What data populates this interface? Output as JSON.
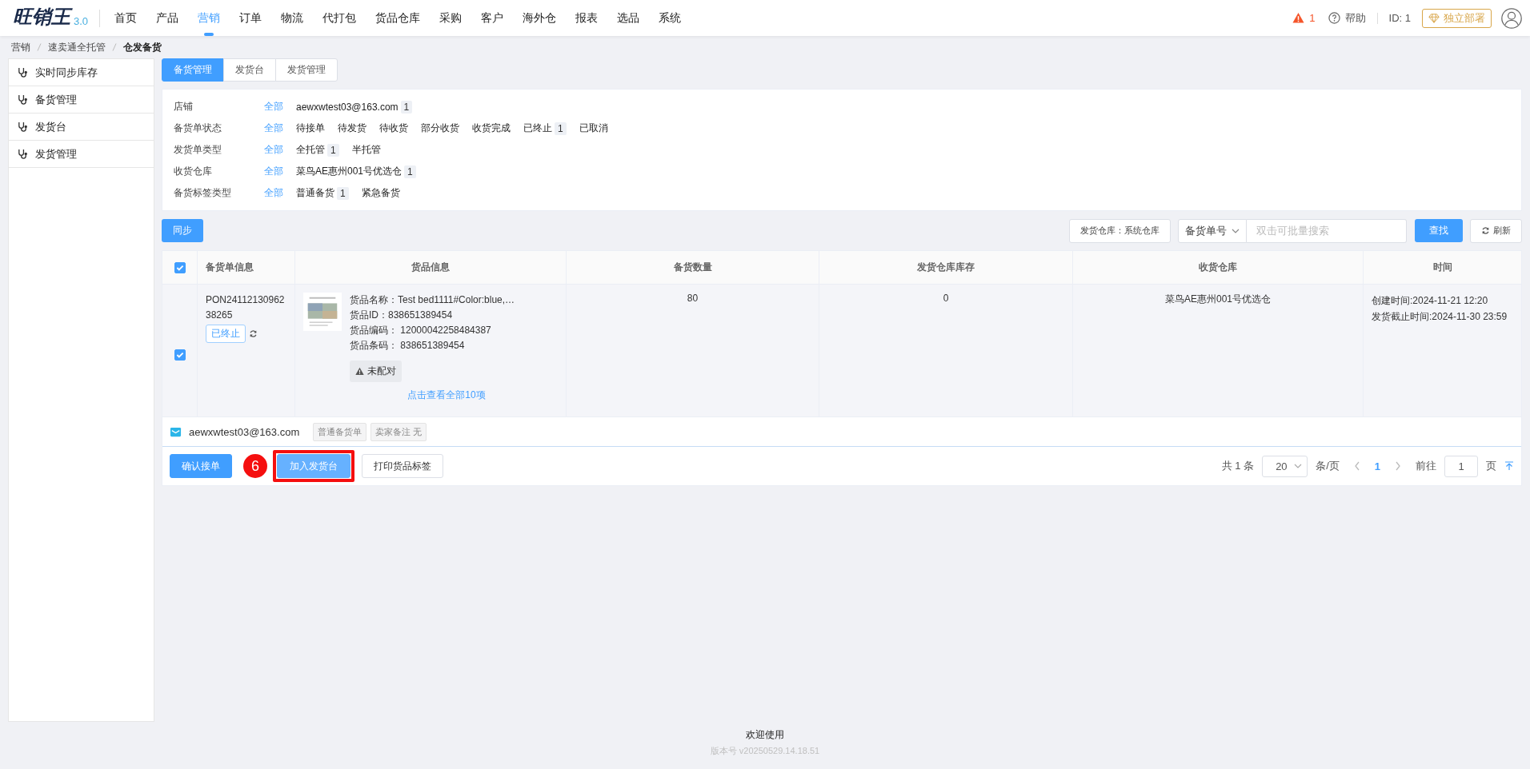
{
  "header": {
    "logo": "旺销王",
    "version": "3.0",
    "nav": [
      {
        "label": "首页",
        "selected": false
      },
      {
        "label": "产品",
        "selected": false
      },
      {
        "label": "营销",
        "selected": true
      },
      {
        "label": "订单",
        "selected": false
      },
      {
        "label": "物流",
        "selected": false
      },
      {
        "label": "代打包",
        "selected": false
      },
      {
        "label": "货品仓库",
        "selected": false
      },
      {
        "label": "采购",
        "selected": false
      },
      {
        "label": "客户",
        "selected": false
      },
      {
        "label": "海外仓",
        "selected": false
      },
      {
        "label": "报表",
        "selected": false
      },
      {
        "label": "选品",
        "selected": false
      },
      {
        "label": "系统",
        "selected": false
      }
    ],
    "alert_count": "1",
    "help": "帮助",
    "user_id": "ID: 1",
    "deploy_button": "独立部署"
  },
  "breadcrumb": [
    "营销",
    "速卖通全托管",
    "仓发备货"
  ],
  "sidebar": {
    "items": [
      "实时同步库存",
      "备货管理",
      "发货台",
      "发货管理"
    ]
  },
  "tabs": [
    {
      "label": "备货管理",
      "selected": true
    },
    {
      "label": "发货台",
      "selected": false
    },
    {
      "label": "发货管理",
      "selected": false
    }
  ],
  "filters": [
    {
      "label": "店铺",
      "options": [
        {
          "label": "全部",
          "selected": true
        },
        {
          "label": "aewxwtest03@163.com",
          "count": "1",
          "selected": false
        }
      ]
    },
    {
      "label": "备货单状态",
      "options": [
        {
          "label": "全部",
          "selected": true
        },
        {
          "label": "待接单",
          "selected": false
        },
        {
          "label": "待发货",
          "selected": false
        },
        {
          "label": "待收货",
          "selected": false
        },
        {
          "label": "部分收货",
          "selected": false
        },
        {
          "label": "收货完成",
          "selected": false
        },
        {
          "label": "已终止",
          "count": "1",
          "selected": false
        },
        {
          "label": "已取消",
          "selected": false
        }
      ]
    },
    {
      "label": "发货单类型",
      "options": [
        {
          "label": "全部",
          "selected": true
        },
        {
          "label": "全托管",
          "count": "1",
          "selected": false
        },
        {
          "label": "半托管",
          "selected": false
        }
      ]
    },
    {
      "label": "收货仓库",
      "options": [
        {
          "label": "全部",
          "selected": true
        },
        {
          "label": "菜鸟AE惠州001号优选仓",
          "count": "1",
          "selected": false
        }
      ]
    },
    {
      "label": "备货标签类型",
      "options": [
        {
          "label": "全部",
          "selected": true
        },
        {
          "label": "普通备货",
          "count": "1",
          "selected": false
        },
        {
          "label": "紧急备货",
          "selected": false
        }
      ]
    }
  ],
  "toolbar": {
    "sync_button": "同步",
    "ship_warehouse": "发货仓库：系统仓库",
    "search_type": "备货单号",
    "search_placeholder": "双击可批量搜索",
    "search_button": "查找",
    "refresh_button": "刷新"
  },
  "table": {
    "header_checked": true,
    "columns": [
      "备货单信息",
      "货品信息",
      "备货数量",
      "发货仓库库存",
      "收货仓库",
      "时间"
    ],
    "rows": [
      {
        "checked": true,
        "order_no": "PON2411213096238265",
        "status": "已终止",
        "product_lines": [
          "货品名称：Test bed1111#Color:blue,…",
          "货品ID：838651389454",
          "货品编码：  12000042258484387",
          "货品条码：  838651389454"
        ],
        "match_tag": "未配对",
        "more_link": "点击查看全部10项",
        "quantity": "80",
        "stock": "0",
        "warehouse": "菜鸟AE惠州001号优选仓",
        "times": [
          "创建时间:2024-11-21 12:20",
          "发货截止时间:2024-11-30 23:59"
        ],
        "store_email": "aewxwtest03@163.com",
        "tags": [
          "普通备货单",
          "卖家备注 无"
        ]
      }
    ]
  },
  "actions": [
    {
      "label": "确认接单",
      "kind": "primary",
      "highlighted": false
    },
    {
      "label": "加入发货台",
      "kind": "light",
      "highlighted": true
    },
    {
      "label": "打印货品标签",
      "kind": "plain",
      "highlighted": false
    }
  ],
  "step_marker": "6",
  "pagination": {
    "total": "共 1 条",
    "page_size": "20",
    "per_page": "条/页",
    "pages": [
      {
        "label": "1",
        "selected": true
      }
    ],
    "goto": "前往",
    "goto_value": "1",
    "page_unit": "页"
  },
  "footer": {
    "welcome": "欢迎使用",
    "version": "版本号 v20250529.14.18.51"
  }
}
